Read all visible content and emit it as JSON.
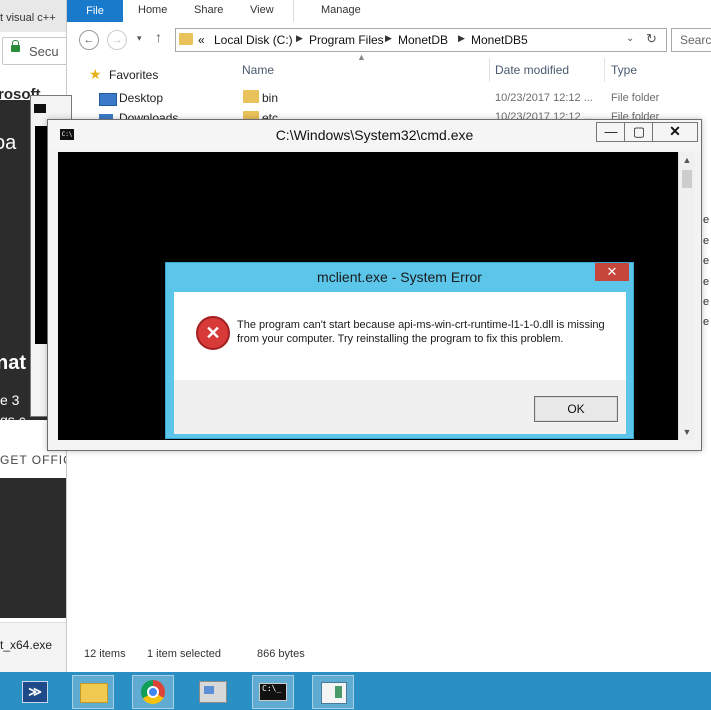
{
  "browser": {
    "tab_text": "t visual c++",
    "address_text": "Secu",
    "brand_text": "rosoft",
    "hero_download": "oa",
    "hero_big": "nat",
    "hero_line1": "e 3",
    "hero_line2": "gs c",
    "get_office": "GET OFFIC",
    "download_file": "t_x64.exe"
  },
  "explorer": {
    "ribbon": {
      "file": "File",
      "home": "Home",
      "share": "Share",
      "view": "View",
      "manage": "Manage"
    },
    "nav": {
      "back": "←",
      "forward": "→",
      "history": "▾",
      "up": "↑"
    },
    "breadcrumb": [
      "«",
      "Local Disk (C:)",
      "Program Files",
      "MonetDB",
      "MonetDB5"
    ],
    "search_placeholder": "Search",
    "nav_pane": {
      "favorites": "Favorites",
      "items": [
        "Desktop",
        "Downloads"
      ]
    },
    "columns": {
      "name": "Name",
      "date": "Date modified",
      "type": "Type"
    },
    "rows": [
      {
        "name": "bin",
        "date": "10/23/2017 12:12 ...",
        "type": "File folder"
      },
      {
        "name": "etc",
        "date": "10/23/2017 12:12 ...",
        "type": "File folder"
      }
    ],
    "edge_chars": [
      "e",
      "e",
      "e",
      "e",
      "e",
      "e",
      "e"
    ],
    "status": {
      "items": "12 items",
      "selected": "1 item selected",
      "size": "866 bytes"
    }
  },
  "cmd": {
    "title": "C:\\Windows\\System32\\cmd.exe",
    "icon_text": "C:\\",
    "min": "—",
    "max": "▢",
    "close": "✕"
  },
  "dialog": {
    "title": "mclient.exe - System Error",
    "close": "✕",
    "message": "The program can't start because api-ms-win-crt-runtime-l1-1-0.dll is missing from your computer. Try reinstalling the program to fix this problem.",
    "ok_label": "OK"
  },
  "taskbar": {
    "powershell_glyph": "≫",
    "cmd_glyph": "C:\\_"
  }
}
